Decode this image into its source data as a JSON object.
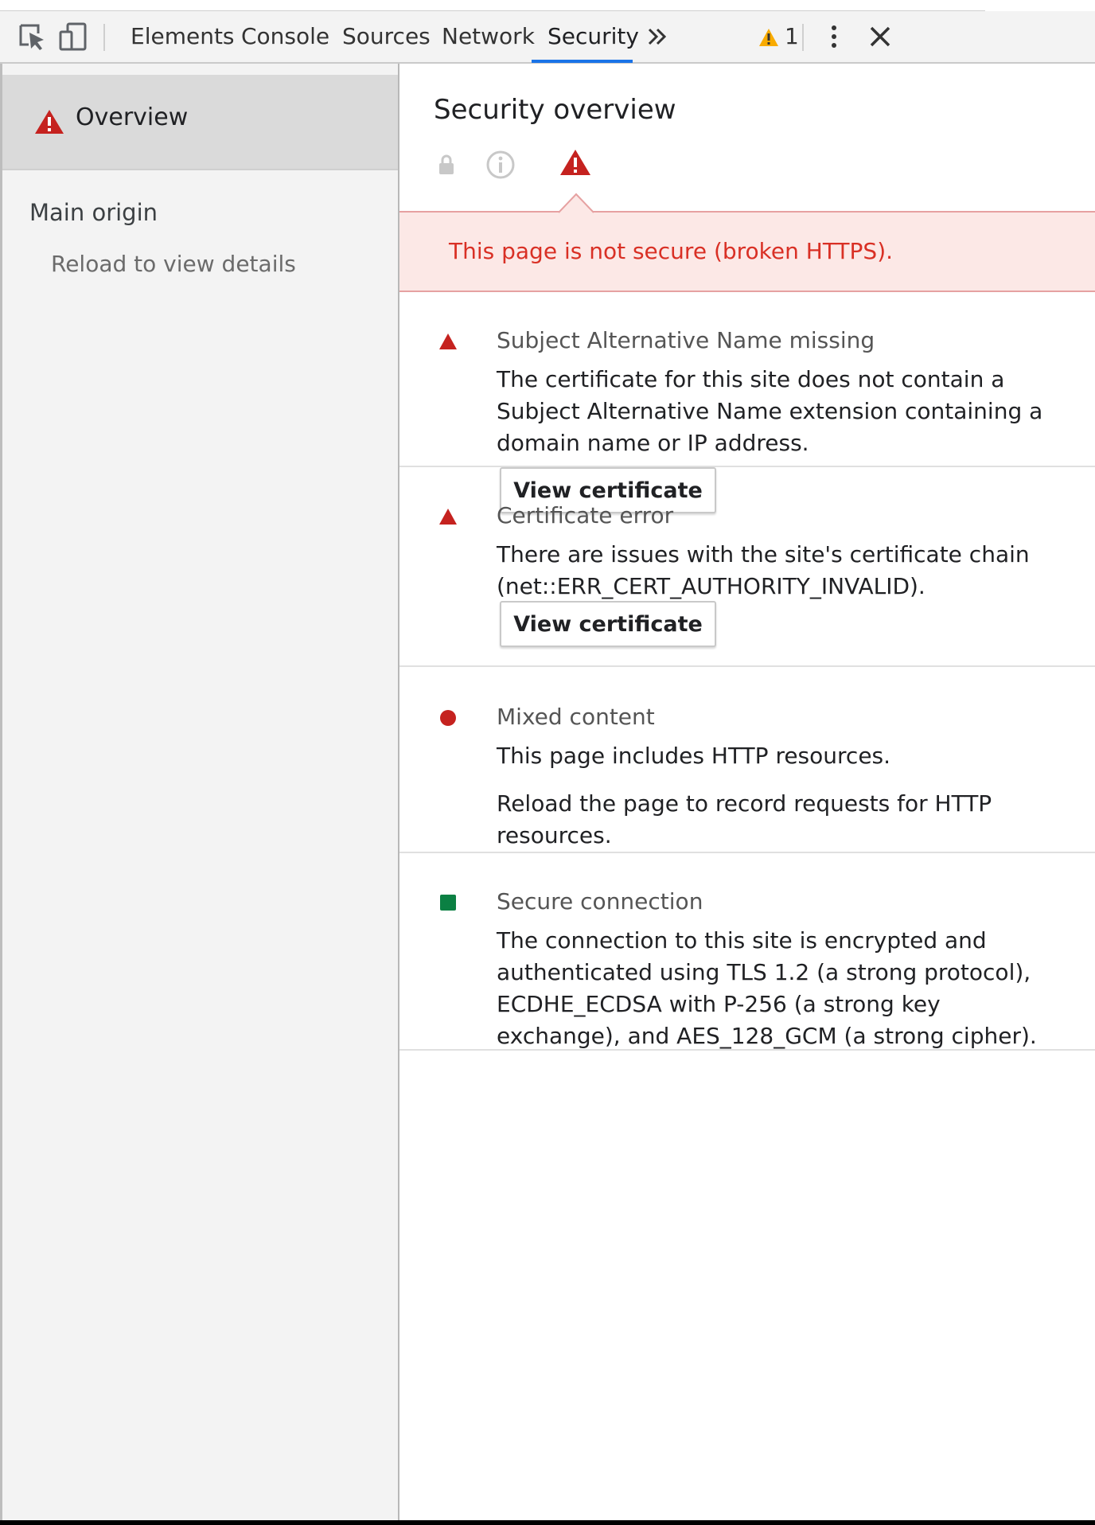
{
  "toolbar": {
    "tabs": [
      "Elements",
      "Console",
      "Sources",
      "Network",
      "Security"
    ],
    "active_tab": "Security",
    "warning_count": "1",
    "icons": [
      "inspect-element-icon",
      "device-toolbar-icon",
      "more-tabs-chevron-icon",
      "warning-icon",
      "kebab-menu-icon",
      "close-icon"
    ]
  },
  "sidebar": {
    "overview_label": "Overview",
    "main_origin": "Main origin",
    "reload_text": "Reload to view details"
  },
  "main": {
    "title": "Security overview",
    "summary": "This page is not secure (broken HTTPS).",
    "cards": [
      {
        "title": "Subject Alternative Name missing",
        "text": "The certificate for this site does not contain a Subject Alternative Name extension containing a domain name or IP address.",
        "button": "View certificate",
        "status": "error"
      },
      {
        "title": "Certificate error",
        "text": "There are issues with the site's certificate chain (net::ERR_CERT_AUTHORITY_INVALID).",
        "button": "View certificate",
        "status": "error"
      },
      {
        "title": "Mixed content",
        "text": "This page includes HTTP resources.",
        "text2": "Reload the page to record requests for HTTP resources.",
        "status": "error-dot"
      },
      {
        "title": "Secure connection",
        "text": "The connection to this site is encrypted and authenticated using TLS 1.2 (a strong protocol), ECDHE_ECDSA with P-256 (a strong key exchange), and AES_128_GCM (a strong cipher).",
        "status": "secure"
      }
    ]
  },
  "colors": {
    "error": "#c5221f",
    "secure": "#0b8043",
    "accent": "#1a73e8",
    "warning": "#f9ab00"
  }
}
